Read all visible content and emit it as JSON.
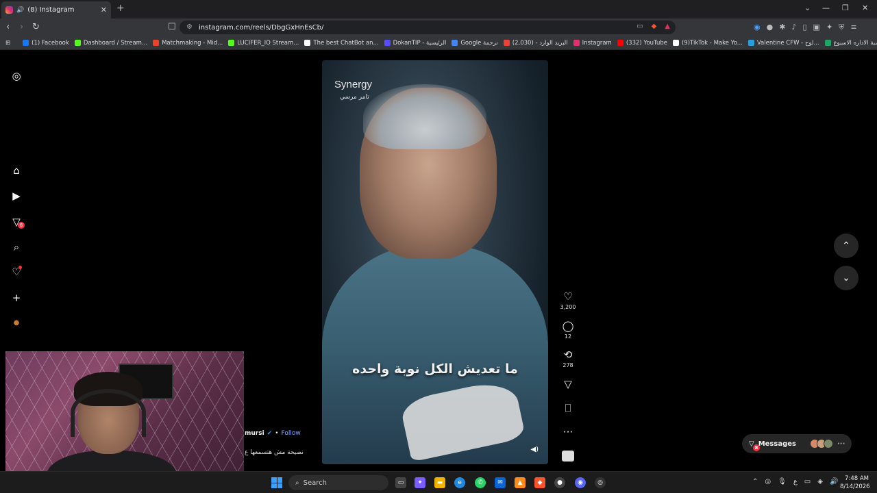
{
  "browser": {
    "tab_title": "(8) Instagram",
    "url": "instagram.com/reels/DbgGxHnEsCb/",
    "bookmarks": [
      {
        "label": "(1) Facebook",
        "color": "#1877f2"
      },
      {
        "label": "Dashboard / Stream...",
        "color": "#53fc18"
      },
      {
        "label": "Matchmaking - Mid...",
        "color": "#e8442b"
      },
      {
        "label": "LUCIFER_IO Stream...",
        "color": "#53fc18"
      },
      {
        "label": "The best ChatBot an...",
        "color": "#ffffff"
      },
      {
        "label": "DokanTIP - الرئيسية",
        "color": "#5b4bff"
      },
      {
        "label": "Google ترجمة",
        "color": "#4285f4"
      },
      {
        "label": "البريد الوارد - (2,030)",
        "color": "#ea4335"
      },
      {
        "label": "Instagram",
        "color": "#e1306c"
      },
      {
        "label": "(332) YouTube",
        "color": "#ff0000"
      },
      {
        "label": "(9)TikTok - Make Yo...",
        "color": "#ffffff"
      },
      {
        "label": "Valentine CFW - لوح...",
        "color": "#2d9cdb"
      },
      {
        "label": "حسبة الاداره الاسبوع...",
        "color": "#21a366"
      }
    ]
  },
  "sidebar": {
    "notifications_badge": "8"
  },
  "reel": {
    "brand": "Synergy",
    "brand_sub": "تامر مرسي",
    "caption": "ما تعديش الكل نوبة واحده",
    "likes": "3,200",
    "comments": "12",
    "reposts": "278",
    "author": "mursi",
    "follow_label": "Follow",
    "description": "نصيحة مش هتسمعها غ"
  },
  "messages": {
    "label": "Messages",
    "badge": "8"
  },
  "taskbar": {
    "search_placeholder": "Search",
    "time": "7:48 AM",
    "date": "8/14/2026",
    "lang": "ع"
  }
}
